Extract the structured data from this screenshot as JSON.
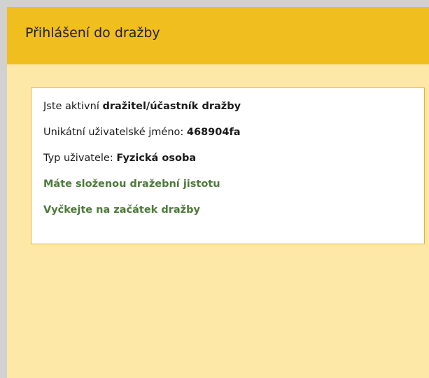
{
  "panel": {
    "title": "Přihlášení do dražby"
  },
  "status": {
    "active_prefix": "Jste aktivní ",
    "active_role": "dražitel/účastník dražby",
    "username_label": "Unikátní uživatelské jméno: ",
    "username_value": "468904fa",
    "user_type_label": "Typ uživatele: ",
    "user_type_value": "Fyzická osoba",
    "deposit_message": "Máte složenou dražební jistotu",
    "wait_message": "Vyčkejte na začátek dražby"
  },
  "colors": {
    "header_background": "#f0be1f",
    "panel_background": "#fde8a8",
    "success_text": "#4d7a3a"
  }
}
